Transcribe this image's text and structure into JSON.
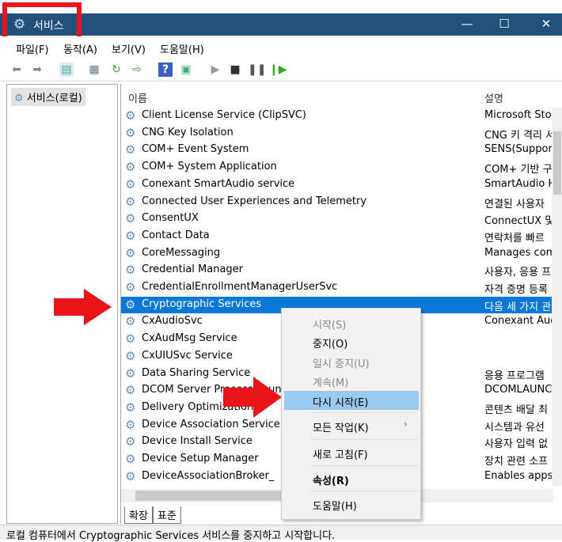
{
  "window": {
    "title": "서비스",
    "minimize": "—",
    "maximize": "☐",
    "close": "✕"
  },
  "menu": [
    "파일(F)",
    "동작(A)",
    "보기(V)",
    "도움말(H)"
  ],
  "toolbar_icons": [
    "back-icon",
    "forward-icon",
    "show-console-tree-icon",
    "properties-icon",
    "refresh-icon",
    "export-icon",
    "help-icon",
    "action-pane-icon",
    "start-icon",
    "stop-icon",
    "pause-icon",
    "restart-icon"
  ],
  "tree": {
    "root": "서비스(로컬)"
  },
  "columns": {
    "name": "이름",
    "description": "설명"
  },
  "services": [
    {
      "name": "Client License Service (ClipSVC)",
      "desc": "Microsoft Stor"
    },
    {
      "name": "CNG Key Isolation",
      "desc": "CNG 키 격리 서"
    },
    {
      "name": "COM+ Event System",
      "desc": "SENS(Supports"
    },
    {
      "name": "COM+ System Application",
      "desc": "COM+ 기반 구"
    },
    {
      "name": "Conexant SmartAudio service",
      "desc": "SmartAudio He"
    },
    {
      "name": "Connected User Experiences and Telemetry",
      "desc": "연결된 사용자"
    },
    {
      "name": "ConsentUX",
      "desc": "ConnectUX 및"
    },
    {
      "name": "Contact Data",
      "desc": "연락처를 빠르"
    },
    {
      "name": "CoreMessaging",
      "desc": "Manages comi"
    },
    {
      "name": "Credential Manager",
      "desc": "사용자, 응용 프"
    },
    {
      "name": "CredentialEnrollmentManagerUserSvc",
      "desc": "자격 증명 등록"
    },
    {
      "name": "Cryptographic Services",
      "desc": "다음 세 가지 관"
    },
    {
      "name": "CxAudioSvc",
      "desc": "Conexant Aud"
    },
    {
      "name": "CxAudMsg Service",
      "desc": ""
    },
    {
      "name": "CxUIUSvc Service",
      "desc": ""
    },
    {
      "name": "Data Sharing Service",
      "desc": "응용 프로그램"
    },
    {
      "name": "DCOM Server Process Launcher",
      "desc": "DCOMLAUNCH"
    },
    {
      "name": "Delivery Optimization",
      "desc": "콘텐츠 배달 최"
    },
    {
      "name": "Device Association Service",
      "desc": "시스템과 유선"
    },
    {
      "name": "Device Install Service",
      "desc": "사용자 입력 없"
    },
    {
      "name": "Device Setup Manager",
      "desc": "장치 관련 소프"
    },
    {
      "name": "DeviceAssociationBroker_",
      "desc": "Enables apps t"
    }
  ],
  "selected_index": 11,
  "context_menu": [
    {
      "label": "시작(S)",
      "state": "disabled"
    },
    {
      "label": "중지(O)",
      "state": "normal"
    },
    {
      "label": "일시 중지(U)",
      "state": "disabled"
    },
    {
      "label": "계속(M)",
      "state": "disabled"
    },
    {
      "label": "다시 시작(E)",
      "state": "highlighted"
    },
    {
      "label": "모든 작업(K)",
      "state": "submenu",
      "arrow": "›"
    },
    {
      "label": "새로 고침(F)",
      "state": "normal"
    },
    {
      "label": "속성(R)",
      "state": "bold"
    },
    {
      "label": "도움말(H)",
      "state": "normal"
    }
  ],
  "tabs": [
    "확장",
    "표준"
  ],
  "status": "로컬 컴퓨터에서 Cryptographic Services 서비스를 중지하고 시작합니다.",
  "colors": {
    "titlebar": "#21507a",
    "selection": "#0b78d7",
    "menu_highlight": "#99c9ef",
    "annotation": "#e8141a"
  }
}
